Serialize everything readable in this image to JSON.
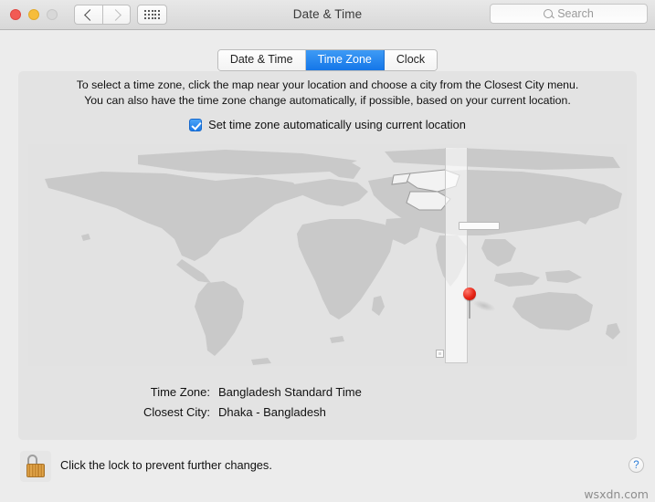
{
  "window": {
    "title": "Date & Time",
    "traffic_lights": [
      "close",
      "minimize",
      "zoom"
    ],
    "nav": {
      "back_icon": "chevron-left-icon",
      "forward_icon": "chevron-right-icon"
    },
    "grid_icon": "grid-apps-icon"
  },
  "search": {
    "placeholder": "Search",
    "icon": "search-icon"
  },
  "tabs": [
    {
      "label": "Date & Time",
      "active": false
    },
    {
      "label": "Time Zone",
      "active": true
    },
    {
      "label": "Clock",
      "active": false
    }
  ],
  "panel": {
    "description_line1": "To select a time zone, click the map near your location and choose a city from the Closest City menu.",
    "description_line2": "You can also have the time zone change automatically, if possible, based on your current location.",
    "auto_checkbox": {
      "label": "Set time zone automatically using current location",
      "checked": true
    },
    "map": {
      "pin_icon": "map-pin-icon",
      "highlight_band_label": "selected-time-zone-band"
    },
    "fields": [
      {
        "label": "Time Zone:",
        "value": "Bangladesh Standard Time"
      },
      {
        "label": "Closest City:",
        "value": "Dhaka - Bangladesh"
      }
    ]
  },
  "bottom": {
    "lock_icon": "unlocked-padlock-icon",
    "lock_text": "Click the lock to prevent further changes.",
    "help_label": "?",
    "watermark": "wsxdn.com"
  },
  "colors": {
    "accent_blue": "#1476e8",
    "land": "#c9c9c9",
    "ocean": "#e2e2e2",
    "pin_red": "#e62315",
    "lock_gold": "#c4862f"
  }
}
